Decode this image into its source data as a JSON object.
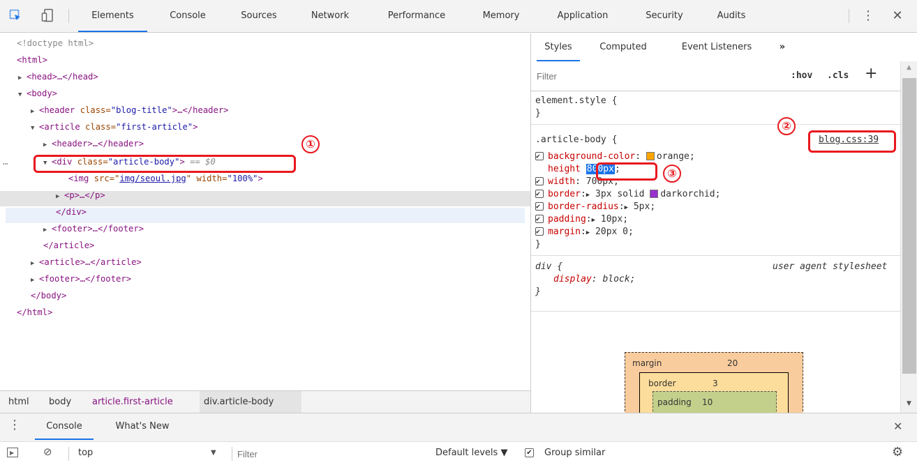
{
  "toolbar": {
    "tabs": [
      "Elements",
      "Console",
      "Sources",
      "Network",
      "Performance",
      "Memory",
      "Application",
      "Security",
      "Audits"
    ],
    "active_tab": "Elements"
  },
  "tree": {
    "lines": {
      "doctype": "<!doctype html>",
      "html_open": "<html>",
      "head": "<head>…</head>",
      "body_open": "<body>",
      "header_tag": "<header ",
      "header_attr": "class=",
      "header_val": "\"blog-title\"",
      "header_close": ">…</header>",
      "article_tag": "<article ",
      "article_attr": "class=",
      "article_val": "\"first-article\"",
      "article_close": ">",
      "inner_header": "<header>…</header>",
      "div_tag": "<div ",
      "div_attr": "class=",
      "div_val": "\"article-body\"",
      "div_close": ">",
      "div_marker": " == $0",
      "img_tag": "<img ",
      "img_src_attr": "src=\"",
      "img_src_link": "img/seoul.jpg",
      "img_src_end": "\" ",
      "img_width_attr": "width=",
      "img_width_val": "\"100%\"",
      "img_close": ">",
      "p": "<p>…</p>",
      "div_end": "</div>",
      "footer_inner": "<footer>…</footer>",
      "article_end": "</article>",
      "article2": "<article>…</article>",
      "footer": "<footer>…</footer>",
      "body_end": "</body>",
      "html_end": "</html>",
      "ellipsis": "…"
    }
  },
  "breadcrumbs": [
    "html",
    "body",
    "article.first-article",
    "div.article-body"
  ],
  "styles": {
    "tabs": [
      "Styles",
      "Computed",
      "Event Listeners"
    ],
    "more": "»",
    "filter_placeholder": "Filter",
    "hov": ":hov",
    "cls": ".cls",
    "plus": "+",
    "element_style": "element.style {",
    "close_brace": "}",
    "rule_selector": ".article-body {",
    "rule_source": "blog.css:39",
    "props": [
      {
        "name": "background-color",
        "value": "orange",
        "swatch": "#ffa500",
        "checked": true
      },
      {
        "name": "height",
        "value": "800px",
        "checked": false
      },
      {
        "name": "width",
        "value": "700px",
        "checked": true
      },
      {
        "name": "border",
        "value": "3px solid",
        "extra": "darkorchid",
        "swatch": "#9932cc",
        "checked": true,
        "expand": true
      },
      {
        "name": "border-radius",
        "value": "5px",
        "checked": true,
        "expand": true
      },
      {
        "name": "padding",
        "value": "10px",
        "checked": true,
        "expand": true
      },
      {
        "name": "margin",
        "value": "20px 0",
        "checked": true,
        "expand": true
      }
    ],
    "ua_selector": "div {",
    "ua_source": "user agent stylesheet",
    "ua_prop": "display",
    "ua_value": "block",
    "box_model": {
      "margin_label": "margin",
      "margin_value": "20",
      "border_label": "border",
      "border_value": "3",
      "padding_label": "padding",
      "padding_value": "10"
    }
  },
  "annotations": [
    "①",
    "②",
    "③"
  ],
  "drawer": {
    "tabs": [
      "Console",
      "What's New"
    ],
    "active_tab": "Console",
    "context": "top",
    "filter_placeholder": "Filter",
    "levels": "Default levels ▼",
    "group_similar": "Group similar"
  },
  "colors": {
    "accent": "#1a73e8",
    "annotation_red": "#e8181e",
    "margin_bg": "#f9cc9d",
    "border_bg": "#fddd9b",
    "padding_bg": "#c3d08b"
  }
}
